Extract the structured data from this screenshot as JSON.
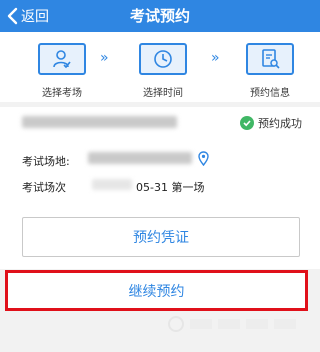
{
  "nav": {
    "back_label": "返回",
    "title": "考试预约"
  },
  "steps": [
    {
      "label": "选择考场",
      "icon": "user-check-icon"
    },
    {
      "label": "选择时间",
      "icon": "clock-icon"
    },
    {
      "label": "预约信息",
      "icon": "document-search-icon"
    }
  ],
  "step_separator": "»",
  "booking": {
    "status": "预约成功",
    "location_label": "考试场地:",
    "session_label": "考试场次",
    "session_value": "05-31 第一场"
  },
  "buttons": {
    "voucher": "预约凭证",
    "continue": "继续预约"
  },
  "colors": {
    "primary": "#2f86e2",
    "success": "#40b765",
    "highlight": "#e0101a"
  }
}
